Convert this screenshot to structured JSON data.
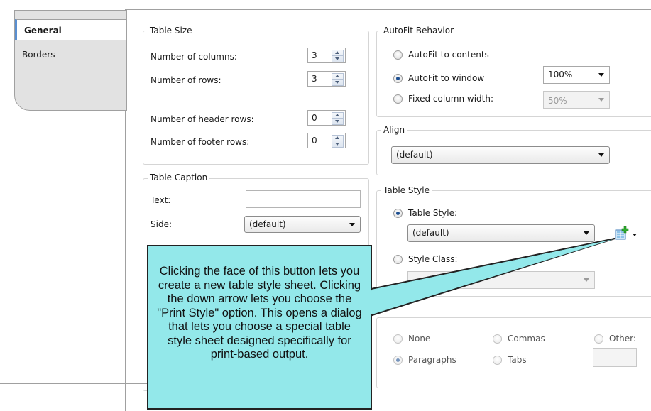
{
  "tabs": [
    {
      "label": "General",
      "active": true
    },
    {
      "label": "Borders",
      "active": false
    }
  ],
  "table_size": {
    "title": "Table Size",
    "columns_label": "Number of columns:",
    "columns_value": "3",
    "rows_label": "Number of rows:",
    "rows_value": "3",
    "header_rows_label": "Number of header rows:",
    "header_rows_value": "0",
    "footer_rows_label": "Number of footer rows:",
    "footer_rows_value": "0"
  },
  "autofit": {
    "title": "AutoFit Behavior",
    "contents_label": "AutoFit to contents",
    "window_label": "AutoFit to window",
    "window_value": "100%",
    "fixed_label": "Fixed column width:",
    "fixed_value": "50%",
    "selected": "AutoFit to window"
  },
  "align": {
    "title": "Align",
    "value": "(default)"
  },
  "caption": {
    "title": "Table Caption",
    "text_label": "Text:",
    "text_value": "",
    "side_label": "Side:",
    "side_value": "(default)"
  },
  "table_style": {
    "title": "Table Style",
    "style_label": "Table Style:",
    "style_value": "(default)",
    "class_label": "Style Class:",
    "class_value": "",
    "selected": "Table Style:"
  },
  "separators": {
    "none_label": "None",
    "commas_label": "Commas",
    "other_label": "Other:",
    "paragraphs_label": "Paragraphs",
    "tabs_label": "Tabs",
    "selected": "Paragraphs"
  },
  "callout": {
    "text": "Clicking the face of this button lets you create a new table style sheet. Clicking the down arrow lets you choose the \"Print Style\" option. This opens a dialog that lets you choose a special table style sheet designed specifically for print-based output."
  },
  "colors": {
    "callout_fill": "#93e8ea",
    "selection_accent": "#5a8fd0"
  }
}
